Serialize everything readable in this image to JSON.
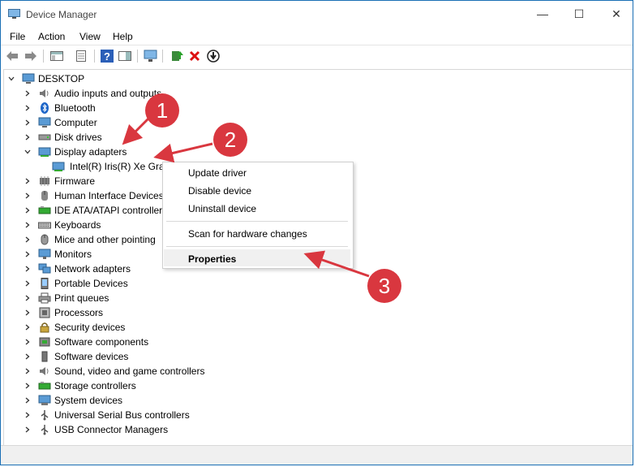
{
  "window": {
    "title": "Device Manager",
    "minimize_glyph": "—",
    "maximize_glyph": "☐",
    "close_glyph": "✕"
  },
  "menu": [
    "File",
    "Action",
    "View",
    "Help"
  ],
  "tree": {
    "root": "DESKTOP",
    "categories": [
      {
        "label": "Audio inputs and outputs",
        "icon": "speaker-icon"
      },
      {
        "label": "Bluetooth",
        "icon": "bluetooth-icon"
      },
      {
        "label": "Computer",
        "icon": "computer-icon"
      },
      {
        "label": "Disk drives",
        "icon": "disk-drive-icon"
      },
      {
        "label": "Display adapters",
        "icon": "display-adapter-icon",
        "expanded": true,
        "children": [
          "Intel(R) Iris(R) Xe Grap"
        ]
      },
      {
        "label": "Firmware",
        "icon": "firmware-icon"
      },
      {
        "label": "Human Interface Devices",
        "icon": "hid-icon"
      },
      {
        "label": "IDE ATA/ATAPI controller",
        "icon": "ide-controller-icon"
      },
      {
        "label": "Keyboards",
        "icon": "keyboard-icon"
      },
      {
        "label": "Mice and other pointing",
        "icon": "mouse-icon"
      },
      {
        "label": "Monitors",
        "icon": "monitor-icon"
      },
      {
        "label": "Network adapters",
        "icon": "network-adapter-icon"
      },
      {
        "label": "Portable Devices",
        "icon": "portable-device-icon"
      },
      {
        "label": "Print queues",
        "icon": "printer-icon"
      },
      {
        "label": "Processors",
        "icon": "processor-icon"
      },
      {
        "label": "Security devices",
        "icon": "security-device-icon"
      },
      {
        "label": "Software components",
        "icon": "software-component-icon"
      },
      {
        "label": "Software devices",
        "icon": "software-device-icon"
      },
      {
        "label": "Sound, video and game controllers",
        "icon": "sound-controller-icon"
      },
      {
        "label": "Storage controllers",
        "icon": "storage-controller-icon"
      },
      {
        "label": "System devices",
        "icon": "system-device-icon"
      },
      {
        "label": "Universal Serial Bus controllers",
        "icon": "usb-icon"
      },
      {
        "label": "USB Connector Managers",
        "icon": "usb-connector-icon"
      }
    ]
  },
  "context_menu": {
    "items": [
      "Update driver",
      "Disable device",
      "Uninstall device",
      "Scan for hardware changes",
      "Properties"
    ],
    "highlighted": "Properties"
  },
  "callouts": [
    "1",
    "2",
    "3"
  ],
  "colors": {
    "callout": "#d9373f",
    "accent": "#1a6fb5"
  }
}
